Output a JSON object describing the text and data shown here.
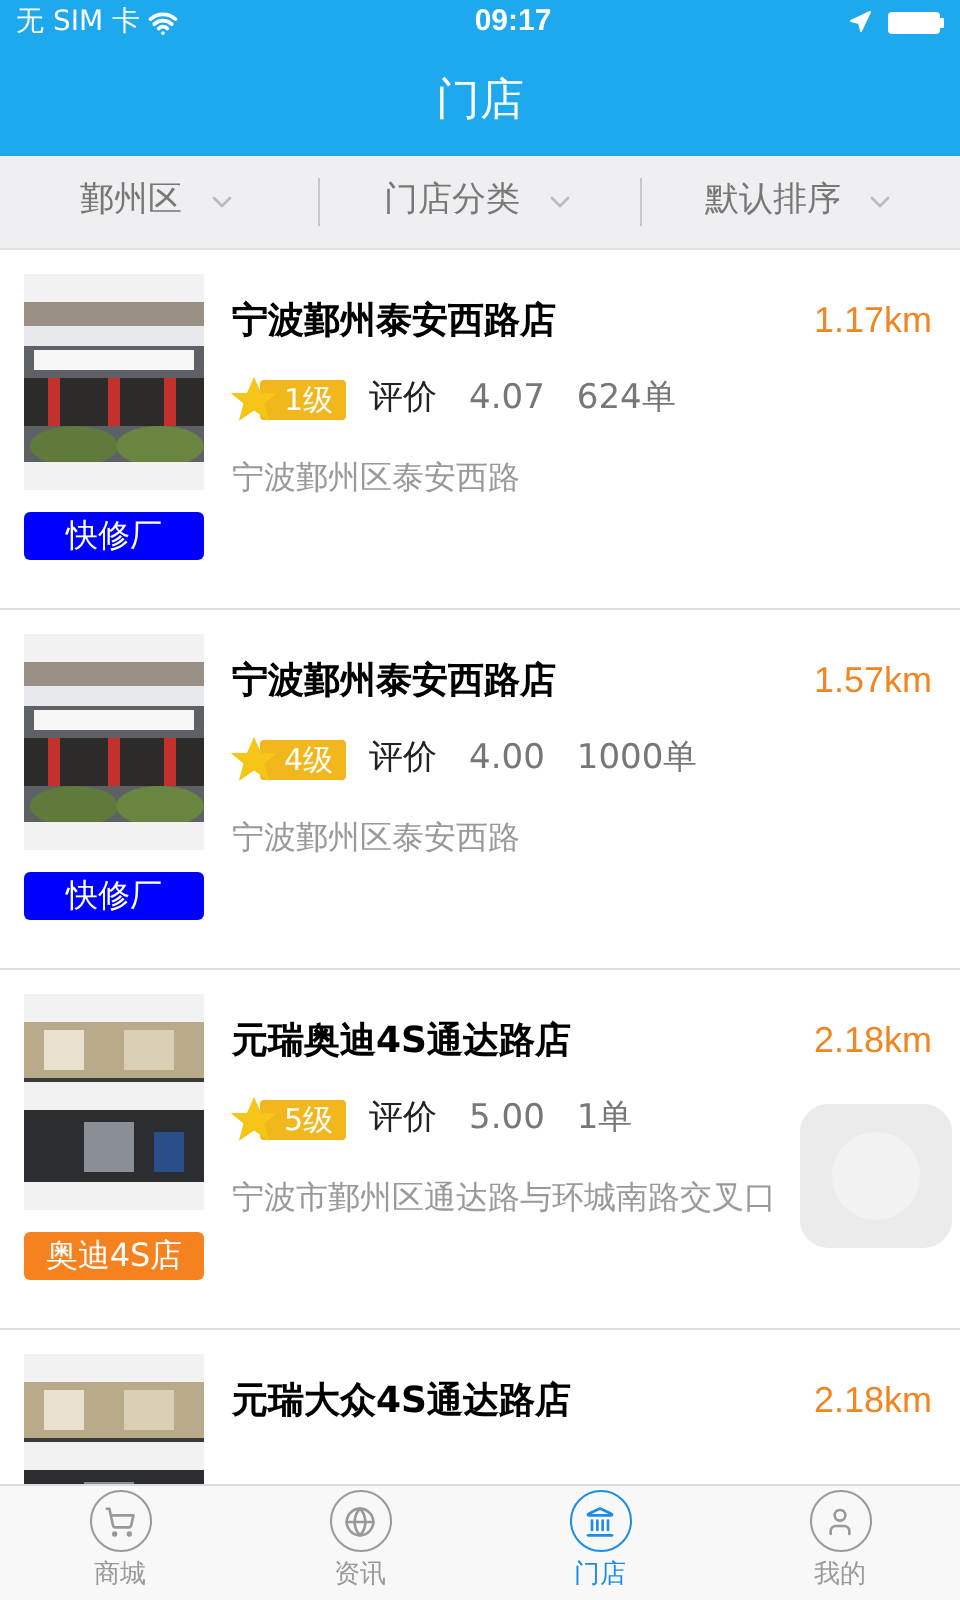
{
  "status_bar": {
    "carrier": "无 SIM 卡",
    "time": "09:17"
  },
  "header": {
    "title": "门店"
  },
  "filters": [
    {
      "label": "鄞州区"
    },
    {
      "label": "门店分类"
    },
    {
      "label": "默认排序"
    }
  ],
  "stores": [
    {
      "name": "宁波鄞州泰安西路店",
      "distance": "1.17km",
      "level": "1级",
      "rating_label": "评价",
      "rating": "4.07",
      "orders": "624单",
      "address": "宁波鄞州区泰安西路",
      "tag": "快修厂",
      "color": "#0000ff"
    },
    {
      "name": "宁波鄞州泰安西路店",
      "distance": "1.57km",
      "level": "4级",
      "rating_label": "评价",
      "rating": "4.00",
      "orders": "1000单",
      "address": "宁波鄞州区泰安西路",
      "tag": "快修厂",
      "color": "#0000ff"
    },
    {
      "name": "元瑞奥迪4S通达路店",
      "distance": "2.18km",
      "level": "5级",
      "rating_label": "评价",
      "rating": "5.00",
      "orders": "1单",
      "address": "宁波市鄞州区通达路与环城南路交叉口",
      "tag": "奥迪4S店",
      "color": "#f5821f"
    },
    {
      "name": "元瑞大众4S通达路店",
      "distance": "2.18km"
    }
  ],
  "tab_bar": [
    {
      "label": "商城",
      "selected": false
    },
    {
      "label": "资讯",
      "selected": false
    },
    {
      "label": "门店",
      "selected": true
    },
    {
      "label": "我的",
      "selected": false
    }
  ]
}
